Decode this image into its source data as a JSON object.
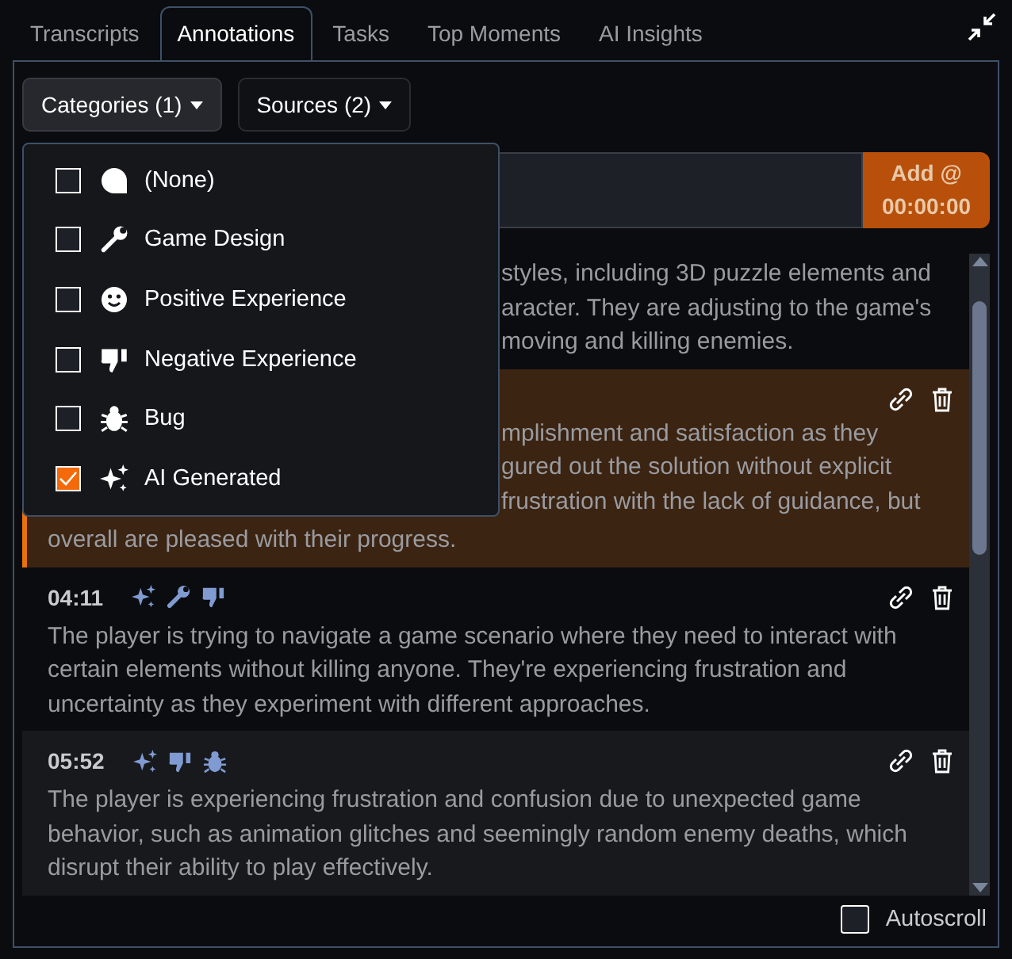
{
  "tabs": [
    {
      "label": "Transcripts",
      "selected": false
    },
    {
      "label": "Annotations",
      "selected": true
    },
    {
      "label": "Tasks",
      "selected": false
    },
    {
      "label": "Top Moments",
      "selected": false
    },
    {
      "label": "AI Insights",
      "selected": false
    }
  ],
  "filters": [
    {
      "label": "Categories (1)",
      "open": true
    },
    {
      "label": "Sources (2)",
      "open": false
    }
  ],
  "add_button": {
    "label_line_1": "Add @",
    "label_line_2": "00:00:00"
  },
  "dropdown": {
    "items": [
      {
        "kind": "none",
        "label": "(None)",
        "checked": false
      },
      {
        "kind": "design",
        "label": "Game Design",
        "checked": false
      },
      {
        "kind": "positive",
        "label": "Positive Experience",
        "checked": false
      },
      {
        "kind": "negative",
        "label": "Negative Experience",
        "checked": false
      },
      {
        "kind": "bug",
        "label": "Bug",
        "checked": false
      },
      {
        "kind": "ai",
        "label": "AI Generated",
        "checked": true
      }
    ]
  },
  "annotations": [
    {
      "selected": false,
      "highlighted": false,
      "lines": [
        "styles, including 3D puzzle elements and",
        "aracter. They are adjusting to the game's",
        "moving and killing enemies."
      ]
    },
    {
      "selected": true,
      "highlighted": false,
      "lines": [
        "mplishment and satisfaction as they",
        "gured out the solution without explicit",
        "frustration with the lack of guidance, but"
      ],
      "tail": "overall are pleased with their progress."
    },
    {
      "selected": false,
      "highlighted": false,
      "time": "04:11",
      "tags": [
        {
          "kind": "ai"
        },
        {
          "kind": "design"
        },
        {
          "kind": "negative"
        }
      ],
      "text": "The player is trying to navigate a game scenario where they need to interact with certain elements without killing anyone. They're experiencing frustration and uncertainty as they experiment with different approaches."
    },
    {
      "selected": false,
      "highlighted": true,
      "time": "05:52",
      "tags": [
        {
          "kind": "ai"
        },
        {
          "kind": "negative"
        },
        {
          "kind": "bug"
        }
      ],
      "text": "The player is experiencing frustration and confusion due to unexpected game behavior, such as animation glitches and seemingly random enemy deaths, which disrupt their ability to play effectively."
    }
  ],
  "autoscroll": {
    "label": "Autoscroll",
    "checked": false
  }
}
